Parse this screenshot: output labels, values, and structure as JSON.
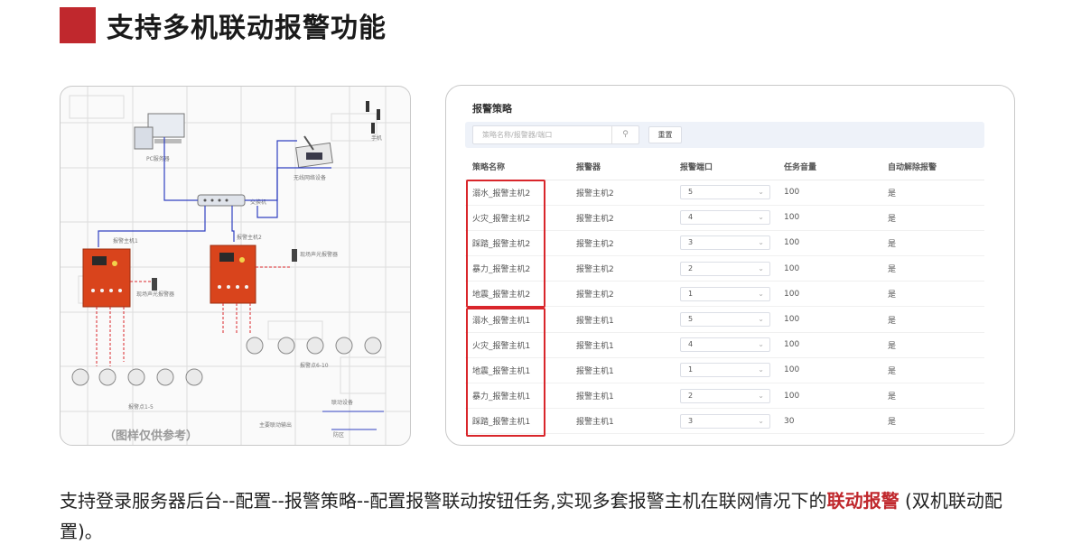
{
  "header": {
    "title": "支持多机联动报警功能"
  },
  "diagram": {
    "caption": "（图样仅供参考）",
    "labels": [
      "PC服务器",
      "无线网络设备",
      "交换机",
      "报警主机1",
      "报警主机2",
      "现场声光报警器",
      "现场声光报警器",
      "报警点1-5",
      "报警点6-10",
      "防区",
      "手机",
      "联动设备",
      "主要联动输出"
    ]
  },
  "panel": {
    "title": "报警策略",
    "search_placeholder": "策略名称/报警器/端口",
    "search_icon": "search-icon",
    "reset_label": "重置",
    "columns": [
      "策略名称",
      "报警器",
      "报警端口",
      "任务音量",
      "自动解除报警"
    ],
    "rows": [
      {
        "name": "溺水_报警主机2",
        "device": "报警主机2",
        "port": "5",
        "volume": "100",
        "auto": "是"
      },
      {
        "name": "火灾_报警主机2",
        "device": "报警主机2",
        "port": "4",
        "volume": "100",
        "auto": "是"
      },
      {
        "name": "踩踏_报警主机2",
        "device": "报警主机2",
        "port": "3",
        "volume": "100",
        "auto": "是"
      },
      {
        "name": "暴力_报警主机2",
        "device": "报警主机2",
        "port": "2",
        "volume": "100",
        "auto": "是"
      },
      {
        "name": "地震_报警主机2",
        "device": "报警主机2",
        "port": "1",
        "volume": "100",
        "auto": "是"
      },
      {
        "name": "溺水_报警主机1",
        "device": "报警主机1",
        "port": "5",
        "volume": "100",
        "auto": "是"
      },
      {
        "name": "火灾_报警主机1",
        "device": "报警主机1",
        "port": "4",
        "volume": "100",
        "auto": "是"
      },
      {
        "name": "地震_报警主机1",
        "device": "报警主机1",
        "port": "1",
        "volume": "100",
        "auto": "是"
      },
      {
        "name": "暴力_报警主机1",
        "device": "报警主机1",
        "port": "2",
        "volume": "100",
        "auto": "是"
      },
      {
        "name": "踩踏_报警主机1",
        "device": "报警主机1",
        "port": "3",
        "volume": "30",
        "auto": "是"
      }
    ]
  },
  "description": {
    "text": "支持登录服务器后台--配置--报警策略--配置报警联动按钮任务,实现多套报警主机在联网情况下的",
    "highlight": "联动报警",
    "suffix": " (双机联动配置)。"
  },
  "colors": {
    "accent": "#c0282d",
    "box_red": "#d9262b",
    "device_orange": "#d9441c",
    "line_blue": "#3040c0"
  }
}
